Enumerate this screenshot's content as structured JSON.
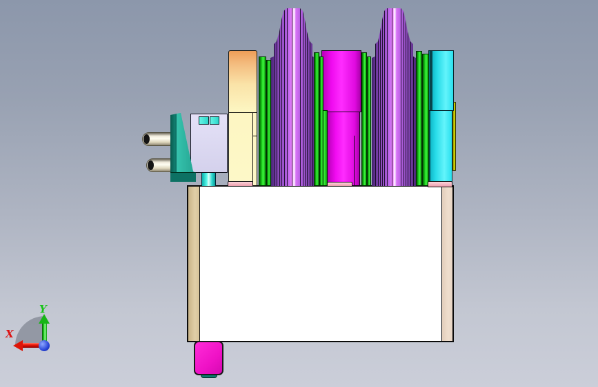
{
  "viewport": {
    "description": "CAD viewport, side view of a mold tool assembly",
    "background_top": "#8c97ab",
    "background_bottom": "#cbced9"
  },
  "axis_triad": {
    "x_label": "X",
    "y_label": "Y",
    "x_color": "#dd1111",
    "y_color": "#18c418",
    "origin_color": "#2a46d8",
    "sector_color": "#6a707c"
  },
  "parts": [
    {
      "name": "ejector-pin-1",
      "color": "#efe9d6"
    },
    {
      "name": "ejector-pin-2",
      "color": "#efe9d6"
    },
    {
      "name": "clamp-block",
      "color": "#2bb3a0"
    },
    {
      "name": "slide-block",
      "color": "#dcd9f1"
    },
    {
      "name": "slide-insert-1",
      "color": "#3fe4d6"
    },
    {
      "name": "slide-insert-2",
      "color": "#3fe4d6"
    },
    {
      "name": "guide-bushing",
      "color": "#2ed8cf"
    },
    {
      "name": "end-plate-left",
      "color": "#fdf6c2"
    },
    {
      "name": "spring-leaf-stack",
      "color": "#22d422"
    },
    {
      "name": "core-tower-left",
      "color": "#a457d4"
    },
    {
      "name": "cavity-block-center",
      "color": "#f00bf0"
    },
    {
      "name": "core-tower-right",
      "color": "#a457d4"
    },
    {
      "name": "end-block-right",
      "color": "#27dbe8"
    },
    {
      "name": "wear-strip",
      "color": "#e8e800"
    },
    {
      "name": "foot-pad",
      "color": "#f5b5c1"
    },
    {
      "name": "base-plate",
      "color": "#ffffff"
    },
    {
      "name": "locating-block",
      "color": "#ef12c6"
    },
    {
      "name": "locating-pad",
      "color": "#0c7a6c"
    }
  ]
}
